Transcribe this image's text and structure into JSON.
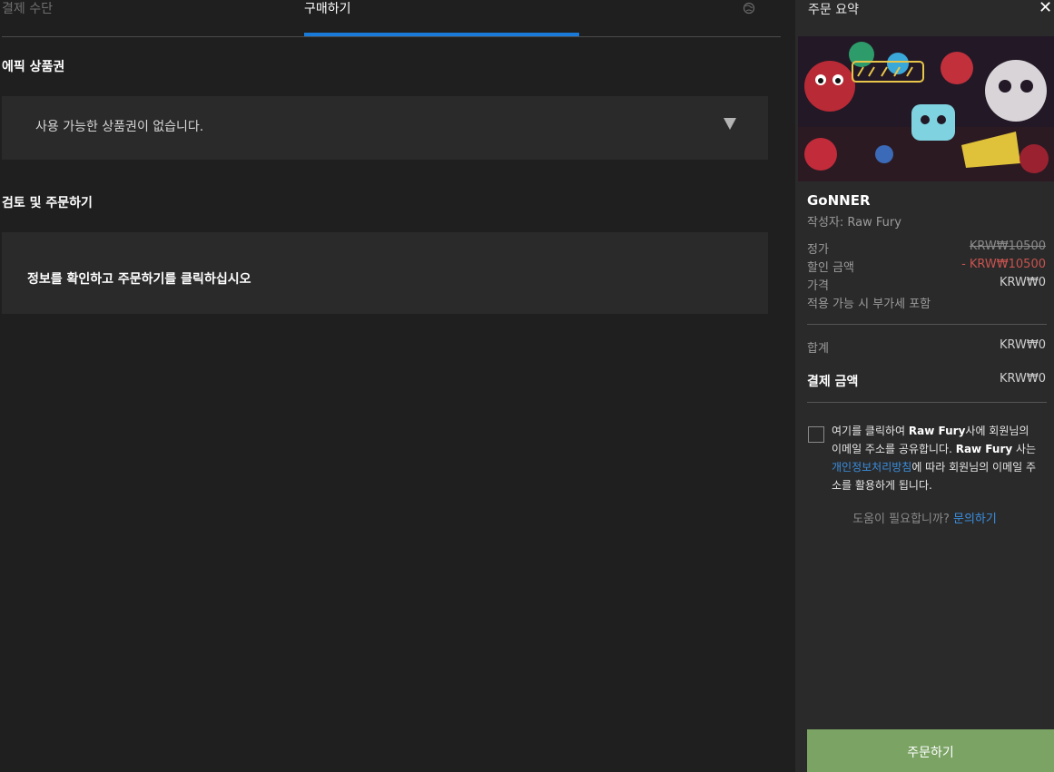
{
  "tabs": {
    "payment_label": "결제 수단",
    "purchase_label": "구매하기"
  },
  "voucher": {
    "title": "에픽 상품권",
    "empty_text": "사용 가능한 상품권이 없습니다."
  },
  "review": {
    "title": "검토 및 주문하기",
    "instruction": "정보를 확인하고 주문하기를 클릭하십시오"
  },
  "summary": {
    "title": "주문 요약",
    "close_icon": "close-icon",
    "game_name": "GoNNER",
    "publisher": "작성자: Raw Fury",
    "rows": {
      "list_price_label": "정가",
      "list_price_value": "KRW₩10500",
      "discount_label": "할인 금액",
      "discount_value": "- KRW₩10500",
      "price_label": "가격",
      "price_value": "KRW₩0",
      "vat_note": "적용 가능 시 부가세 포함",
      "subtotal_label": "합계",
      "subtotal_value": "KRW₩0",
      "total_label": "결제 금액",
      "total_value": "KRW₩0"
    },
    "consent": {
      "part1": "여기를 클릭하여 ",
      "brand1": "Raw Fury",
      "part2": "사에 회원님의 이메일 주소를 공유합니다. ",
      "brand2": "Raw Fury",
      "part3": " 사는 ",
      "link": "개인정보처리방침",
      "part4": "에 따라 회원님의 이메일 주소를 활용하게 됩니다."
    },
    "help_text": "도움이 필요합니까? ",
    "help_link": "문의하기",
    "order_button": "주문하기"
  },
  "colors": {
    "accent_blue": "#1a7ad9",
    "discount_red": "#c9534f",
    "order_green": "#7aa364",
    "link_blue": "#3a8fe0"
  }
}
